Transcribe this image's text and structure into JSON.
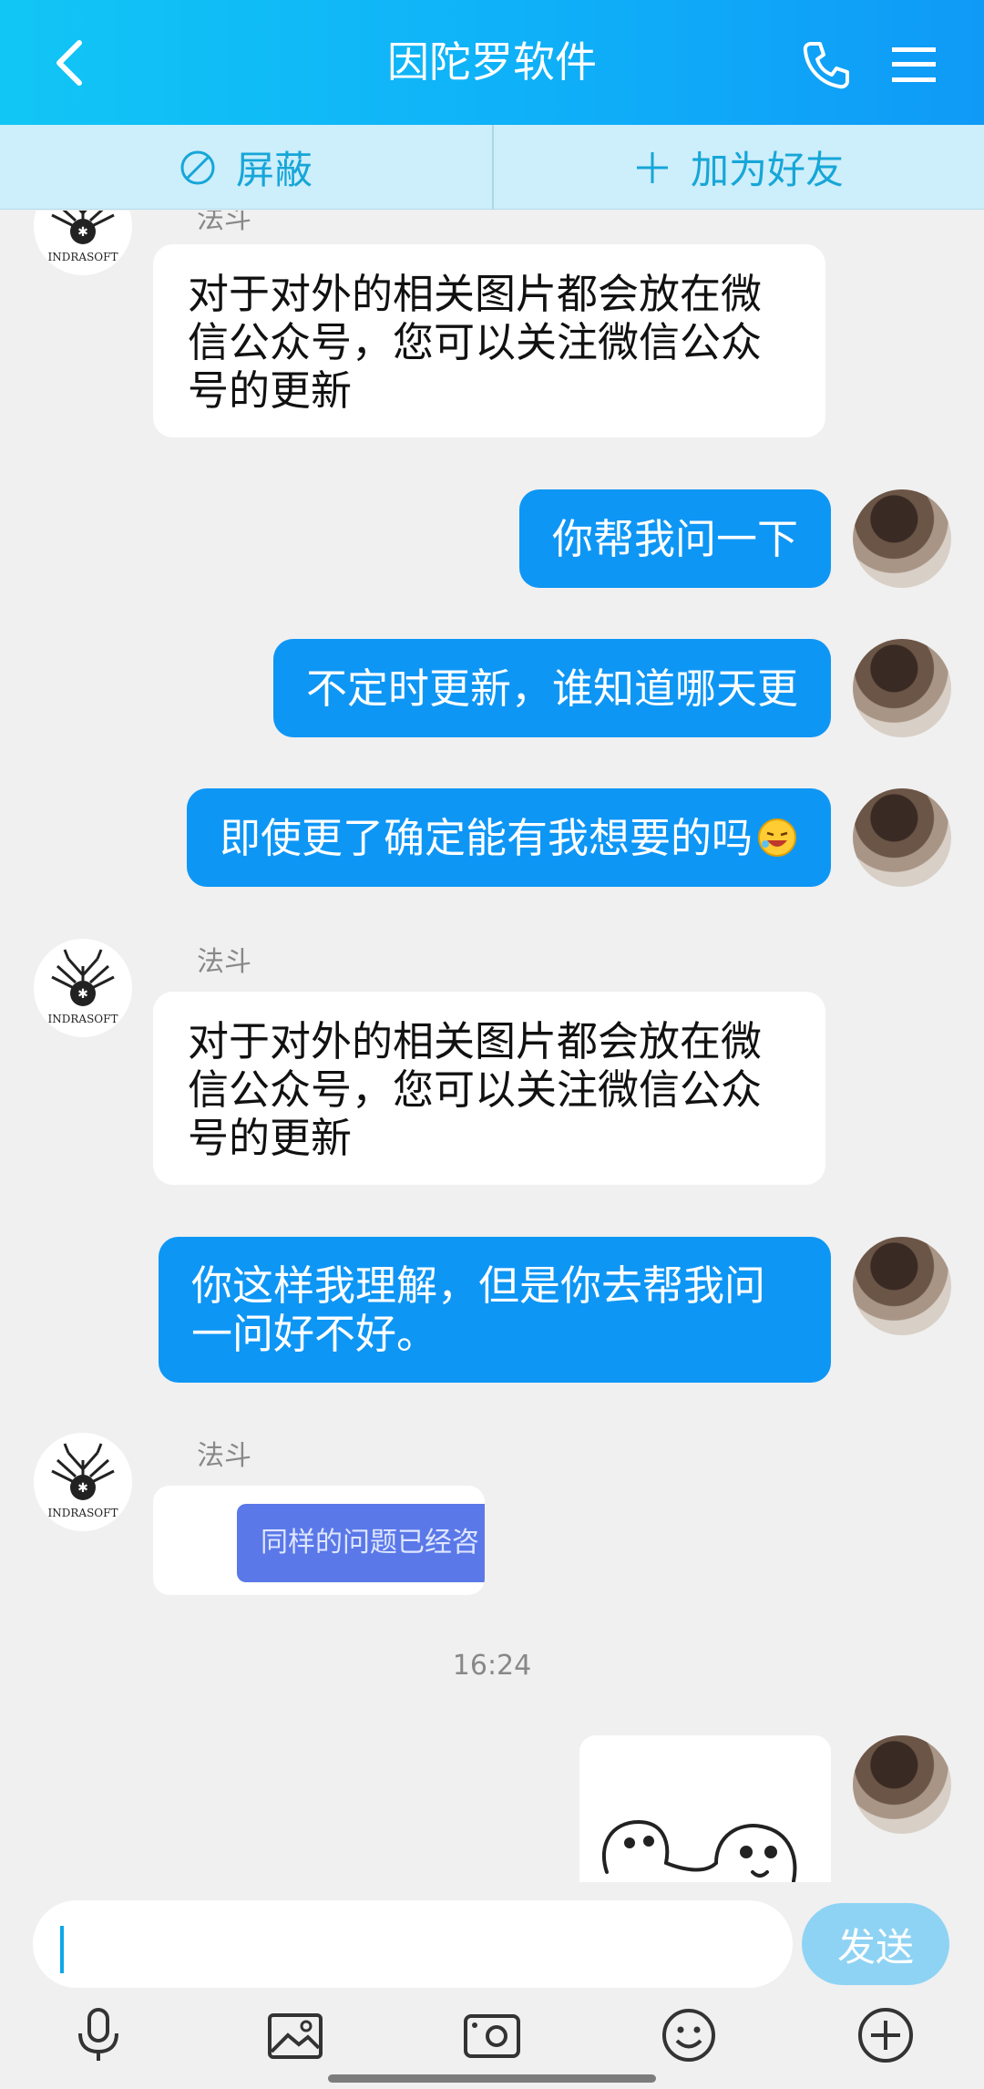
{
  "header": {
    "title": "因陀罗软件",
    "icons": [
      "back-icon",
      "phone-icon",
      "menu-icon"
    ]
  },
  "actions": {
    "block_label": "屏蔽",
    "add_friend_label": "加为好友"
  },
  "messages": [
    {
      "from": "bot",
      "sender": "法斗",
      "text_lines": [
        "对于对外的相关图片都会放在微",
        "信公众号，您可以关注微信公众",
        "号的更新"
      ]
    },
    {
      "from": "me",
      "text": "你帮我问一下"
    },
    {
      "from": "me",
      "text": "不定时更新，谁知道哪天更"
    },
    {
      "from": "me",
      "text": "即使更了确定能有我想要的吗",
      "emoji": "laughing-emoji"
    },
    {
      "from": "bot",
      "sender": "法斗",
      "text_lines": [
        "对于对外的相关图片都会放在微",
        "信公众号，您可以关注微信公众",
        "号的更新"
      ]
    },
    {
      "from": "me",
      "text_lines": [
        "你这样我理解，但是你去帮我问",
        "一问好不好。"
      ]
    },
    {
      "from": "bot",
      "sender": "法斗",
      "image_text": "同样的问题已经咨"
    },
    {
      "from": "time",
      "text": "16:24"
    },
    {
      "from": "me",
      "sticker": "sketch-sticker"
    }
  ],
  "avatar": {
    "bot_logo_text": "INDRASOFT"
  },
  "input": {
    "value": "",
    "send_label": "发送"
  },
  "toolbar": {
    "icons": [
      "mic-icon",
      "image-icon",
      "camera-icon",
      "emoji-icon",
      "plus-icon"
    ]
  },
  "colors": {
    "header": "#11c6f5",
    "out_bubble": "#0e96f5",
    "action_text": "#16a6d8",
    "send_button": "#8fd3f4"
  }
}
